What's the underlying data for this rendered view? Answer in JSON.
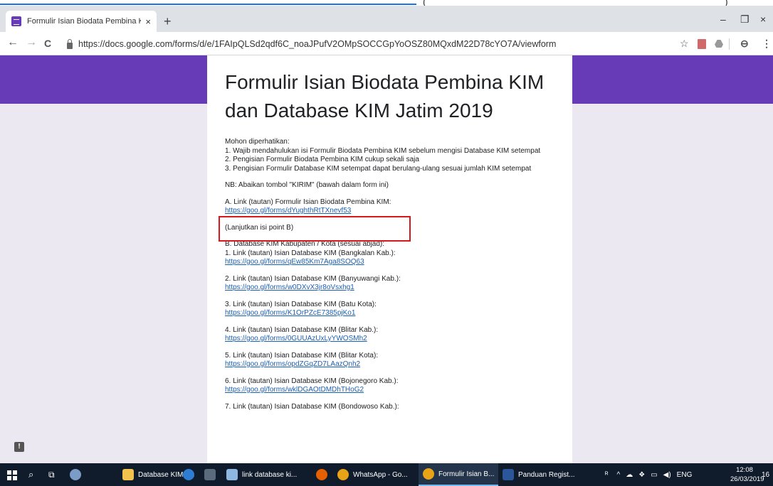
{
  "browser": {
    "tab_title": "Formulir Isian Biodata Pembina K",
    "tab_close": "×",
    "new_tab": "+",
    "url": "https://docs.google.com/forms/d/e/1FAIpQLSd2qdf6C_noaJPufV2OMpSOCCGpYoOSZ80MQxdM22D78cYO7A/viewform",
    "back": "←",
    "forward": "→",
    "reload": "C",
    "star": "☆",
    "account": "⊖",
    "menu": "⋮",
    "minimize": "–",
    "restore": "❐",
    "close": "×",
    "top_fragment_left": "(",
    "top_fragment_right": ")"
  },
  "form": {
    "title": "Formulir Isian Biodata Pembina KIM dan Database KIM Jatim 2019",
    "intro_lines": [
      "Mohon diperhatikan:",
      "1. Wajib mendahulukan isi Formulir Biodata Pembina KIM sebelum mengisi Database KIM setempat",
      "2. Pengisian Formulir Biodata Pembina KIM cukup sekali saja",
      "3. Pengisian Formulir Database KIM setempat dapat berulang-ulang sesuai jumlah KIM setempat"
    ],
    "nb": "NB: Abaikan tombol \"KIRIM\" (bawah dalam form ini)",
    "section_a_label": "A. Link (tautan) Formulir Isian Biodata Pembina KIM:",
    "section_a_link": "https://goo.gl/forms/dYughthRtTXnevf53",
    "continue_note": "(Lanjutkan isi point B)",
    "section_b_title": "B. Database KIM Kabupaten / Kota (sesuai abjad):",
    "links": [
      {
        "label": "1. Link (tautan) Isian Database KIM (Bangkalan Kab.):",
        "url": "https://goo.gl/forms/qEw85Km7Aga8SOQ63"
      },
      {
        "label": "2. Link (tautan) Isian Database KIM (Banyuwangi Kab.):",
        "url": "https://goo.gl/forms/w0DXvX3jr8oVsxhg1"
      },
      {
        "label": "3. Link (tautan) Isian Database KIM (Batu Kota):",
        "url": "https://goo.gl/forms/K1OrPZcE7385pjKo1"
      },
      {
        "label": "4. Link (tautan) Isian Database KIM (Blitar Kab.):",
        "url": "https://goo.gl/forms/0GUUAzUxLyYWOSMh2"
      },
      {
        "label": "5. Link (tautan) Isian Database KIM (Blitar Kota):",
        "url": "https://goo.gl/forms/opdZGqZD7LAazQnh2"
      },
      {
        "label": "6. Link (tautan) Isian Database KIM (Bojonegoro Kab.):",
        "url": "https://goo.gl/forms/wklDGAOtDMDhTHoG2"
      },
      {
        "label": "7. Link (tautan) Isian Database KIM (Bondowoso Kab.):",
        "url": ""
      }
    ],
    "feedback_icon": "!"
  },
  "taskbar": {
    "items": [
      {
        "label": "Database KIM J...",
        "icon": "folder-icon",
        "color": "#f2c14e"
      },
      {
        "label": "",
        "icon": "edge-icon",
        "color": "#2d7dd2"
      },
      {
        "label": "",
        "icon": "calculator-icon",
        "color": "#5a6b7d"
      },
      {
        "label": "link database ki...",
        "icon": "notepad-icon",
        "color": "#8fb8e0"
      },
      {
        "label": "",
        "icon": "firefox-icon",
        "color": "#e66000"
      },
      {
        "label": "WhatsApp - Go...",
        "icon": "chrome-icon",
        "color": "#e8a317"
      },
      {
        "label": "Formulir Isian B...",
        "icon": "chrome-icon",
        "color": "#e8a317"
      },
      {
        "label": "Panduan Regist...",
        "icon": "word-icon",
        "color": "#2b579a"
      }
    ],
    "lang": "ENG",
    "time": "12:08",
    "date": "26/03/2019",
    "notif_count": "16"
  },
  "colors": {
    "brand_purple": "#673ab7",
    "highlight_red": "#d7191c",
    "link_blue": "#1a5fb4"
  }
}
